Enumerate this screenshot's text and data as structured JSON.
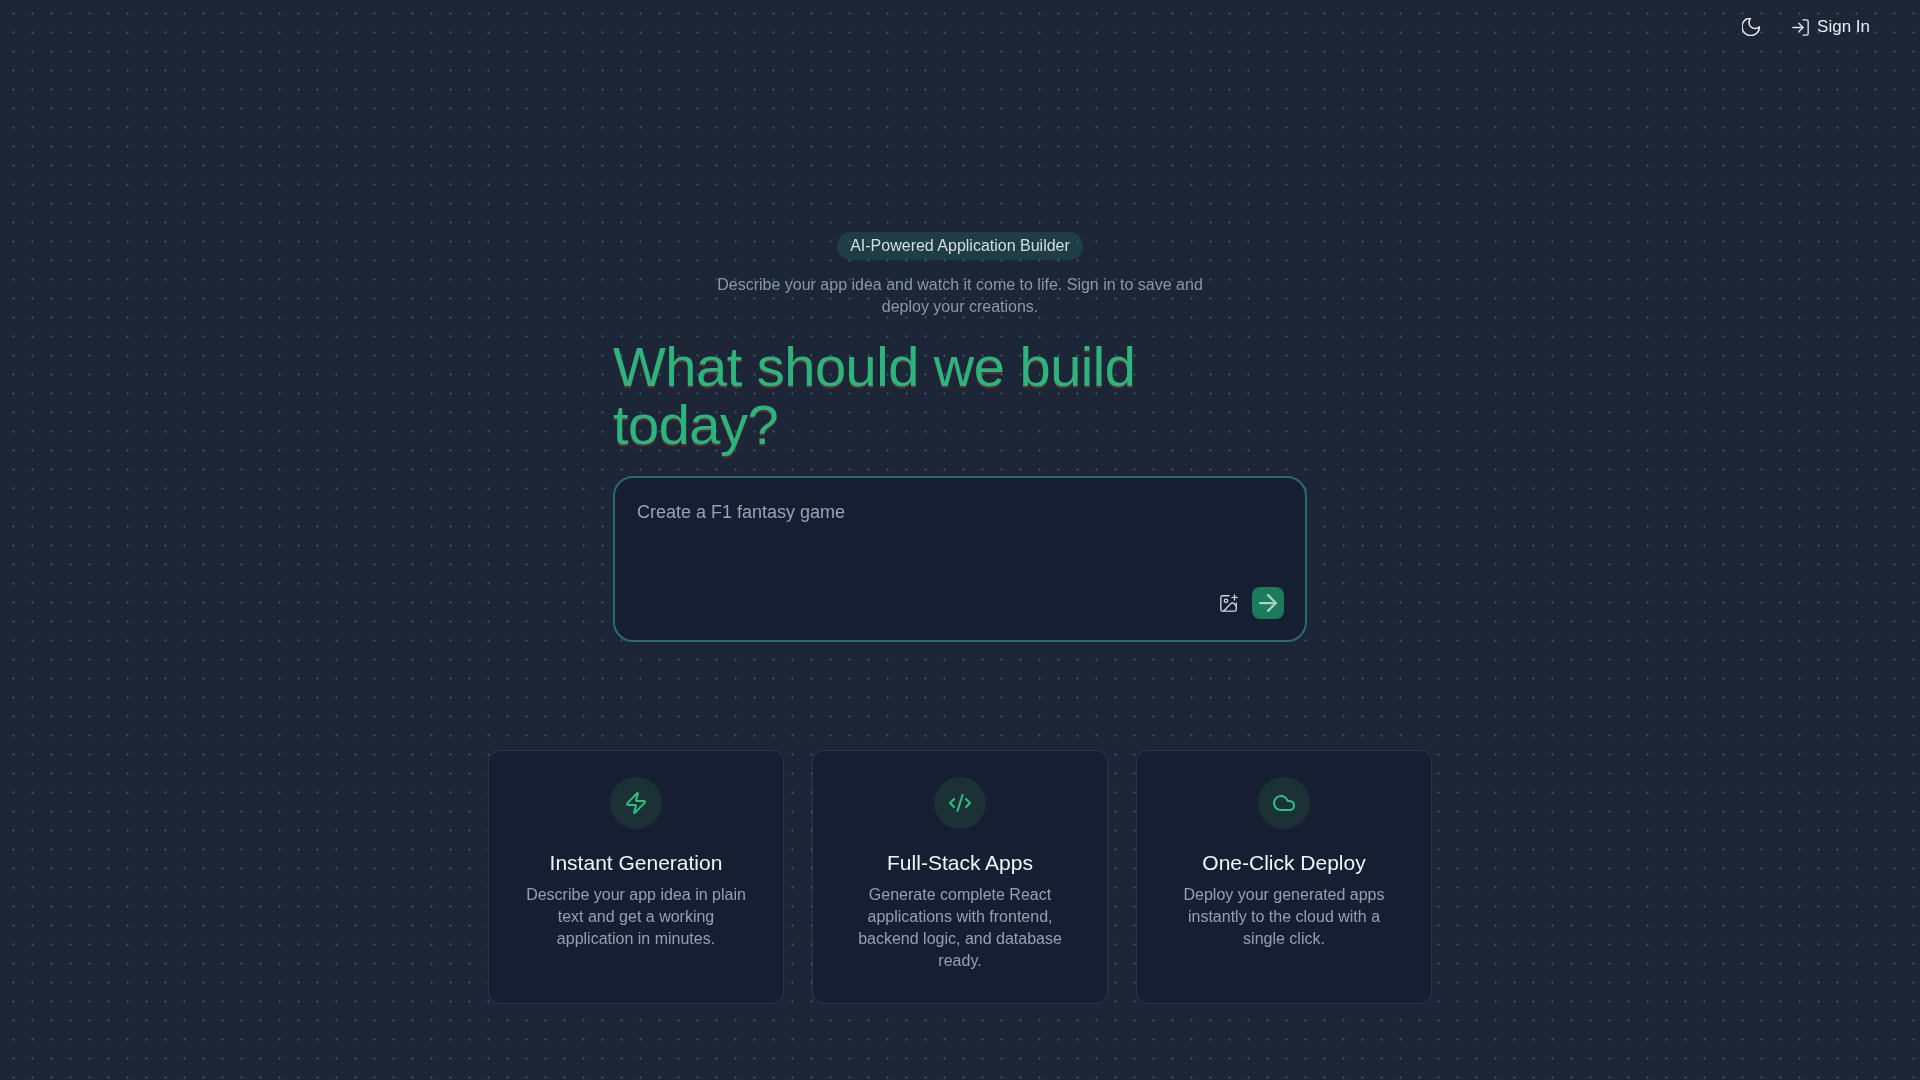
{
  "header": {
    "sign_in": {
      "label": "Sign In"
    }
  },
  "hero": {
    "badge": "AI-Powered Application Builder",
    "subtitle": "Describe your app idea and watch it come to life. Sign in to save and deploy your creations.",
    "heading": "What should we build today?"
  },
  "prompt": {
    "placeholder": "Create a F1 fantasy game"
  },
  "features": [
    {
      "title": "Instant Generation",
      "description": "Describe your app idea in plain text and get a working application in minutes."
    },
    {
      "title": "Full-Stack Apps",
      "description": "Generate complete React applications with frontend, backend logic, and database ready."
    },
    {
      "title": "One-Click Deploy",
      "description": "Deploy your generated apps instantly to the cloud with a single click."
    }
  ]
}
